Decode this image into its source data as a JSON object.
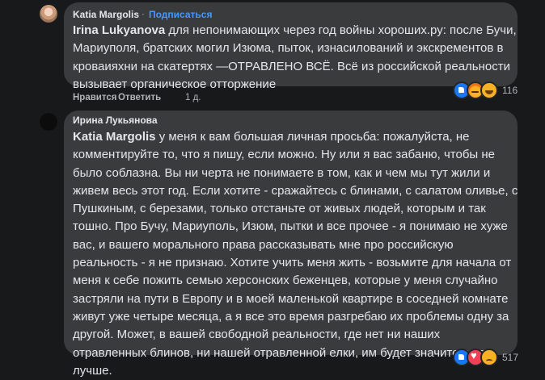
{
  "comment1": {
    "author": "Katia Margolis",
    "separator": "·",
    "follow_label": "Подписаться",
    "mention": "Irina Lukyanova",
    "lines": [
      " для непонимающих через год войны хороших.ру: после Бучи,",
      "Мариуполя, братских могил Изюма, пыток, изнасилований и экскрементов в",
      "кроваияхни на скатертях —ОТРАВЛЕНО ВСЁ. Всё из российской реальности",
      "вызывает органическое отторжение"
    ],
    "actions": {
      "like": "Нравится",
      "reply": "Ответить",
      "time": "1 д."
    },
    "reactions": {
      "icons": [
        "like-icon",
        "angry-icon",
        "haha-icon"
      ],
      "count": "116"
    }
  },
  "comment2": {
    "author": "Ирина Лукьянова",
    "mention": "Katia Margolis",
    "lines": [
      " у меня к вам большая личная просьба: пожалуйста, не",
      "комментируйте то, что я пишу, если можно. Ну или я вас забаню, чтобы не",
      "было соблазна. Вы ни черта не понимаете в том, как и чем мы тут жили и",
      "живем весь этот год. Если хотите - сражайтесь с блинами, с салатом оливье, с",
      "Пушкиным, с березами, только отстаньте от живых людей, которым и так",
      "тошно. Про Бучу, Мариуполь, Изюм, пытки и все прочее - я понимаю не хуже",
      "вас, и вашего морального права рассказывать мне про российскую",
      "реальность - я не признаю. Хотите учить меня жить - возьмите для начала от",
      "меня к себе пожить семью херсонских беженцев, которые у меня случайно",
      "застряли на пути в Европу и в моей маленькой квартире в соседней комнате",
      "живут уже четыре месяца, а я все это время разгребаю их проблемы одну за",
      "другой. Может, в вашей свободной реальности, где нет ни наших",
      "отравленных блинов, ни нашей отравленной елки, им будет значительно",
      "лучше."
    ],
    "reactions": {
      "icons": [
        "like-icon",
        "heart-icon",
        "sad-icon"
      ],
      "count": "517"
    }
  }
}
